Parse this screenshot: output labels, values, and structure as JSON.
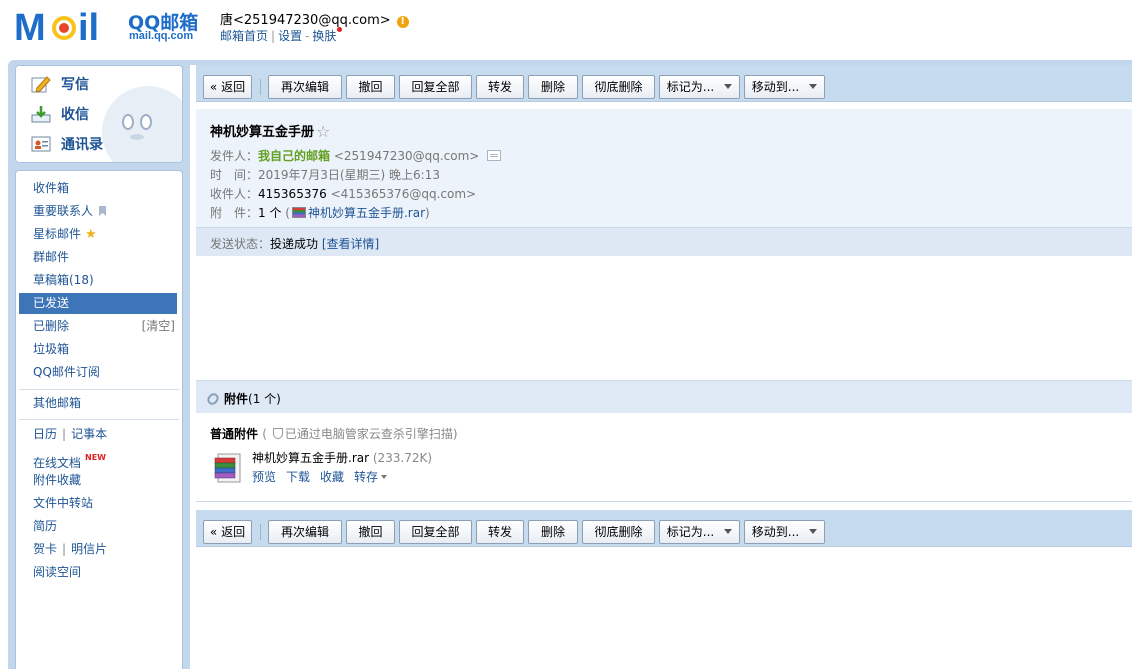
{
  "header": {
    "logo_cn": "QQ邮箱",
    "logo_url": "mail.qq.com",
    "user": "唐<251947230@qq.com>",
    "warn": "!",
    "links": [
      "邮箱首页",
      "设置",
      "换肤"
    ],
    "sep_bar": "|",
    "sep_dash": "-"
  },
  "quick": {
    "write": "写信",
    "receive": "收信",
    "contacts": "通讯录"
  },
  "nav": {
    "inbox": "收件箱",
    "vip": "重要联系人",
    "starred": "星标邮件",
    "star_glyph": "★",
    "group": "群邮件",
    "drafts": "草稿箱(18)",
    "sent": "已发送",
    "deleted": "已删除",
    "clear": "[清空]",
    "spam": "垃圾箱",
    "subscribe": "QQ邮件订阅",
    "others": "其他邮箱",
    "calendar": "日历",
    "notes": "记事本",
    "docs": "在线文档",
    "new_badge": "NEW",
    "att_fav": "附件收藏",
    "transfer": "文件中转站",
    "resume": "简历",
    "card": "贺卡",
    "postcard": "明信片",
    "reading": "阅读空间",
    "sep": "|"
  },
  "toolbar": {
    "back": "« 返回",
    "reedit": "再次编辑",
    "recall": "撤回",
    "reply_all": "回复全部",
    "forward": "转发",
    "delete": "删除",
    "delete_perm": "彻底删除",
    "mark": "标记为...",
    "move": "移动到..."
  },
  "mail": {
    "subject": "神机妙算五金手册",
    "star": "☆",
    "from_label": "发件人：",
    "from_name": "我自己的邮箱",
    "from_addr": "<251947230@qq.com>",
    "time_label": "时　间：",
    "time": "2019年7月3日(星期三) 晚上6:13",
    "to_label": "收件人：",
    "to_name": "415365376",
    "to_addr": "<415365376@qq.com>",
    "att_label": "附　件：",
    "att_count": "1 个",
    "att_paren_open": "(",
    "att_file": "神机妙算五金手册.rar",
    "att_paren_close": ")",
    "status_label": "发送状态：",
    "status": "投递成功",
    "status_link": "[查看详情]"
  },
  "attachment": {
    "title": "附件",
    "count": "(1 个)",
    "kind": "普通附件",
    "scan_open": "(",
    "scan": "已通过电脑管家云查杀引擎扫描",
    "scan_close": ")",
    "name": "神机妙算五金手册.rar",
    "size": "(233.72K)",
    "actions": [
      "预览",
      "下载",
      "收藏",
      "转存"
    ]
  },
  "colors": {
    "accent": "#3e74b8",
    "frame": "#c2d7ec",
    "link": "#1e5494",
    "sender_green": "#62a023"
  }
}
